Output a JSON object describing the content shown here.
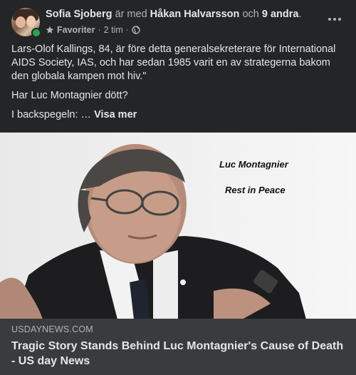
{
  "post": {
    "author": "Sofia Sjoberg",
    "with_text": "är med",
    "tagged_person": "Håkan Halvarsson",
    "and_text": "och",
    "others": "9 andra",
    "period": ".",
    "audience": "Favoriter",
    "separator": "·",
    "time": "2 tim",
    "separator2": "·",
    "paragraphs": [
      "Lars-Olof Kallings, 84, är före detta generalsekreterare för International AIDS Society, IAS, och har sedan 1985 varit en av strategerna bakom den globala kampen mot hiv.\"",
      "Har Luc Montagnier dött?"
    ],
    "last_line_prefix": "I backspegeln: …",
    "see_more": "Visa mer"
  },
  "image": {
    "caption_name": "Luc Montagnier",
    "caption_rip": "Rest in Peace"
  },
  "link": {
    "domain": "USDAYNEWS.COM",
    "title": "Tragic Story Stands Behind Luc Montagnier's Cause of Death - US day News"
  },
  "colors": {
    "background": "#242526",
    "link_card": "#3a3b3c",
    "online": "#31a24c",
    "text_primary": "#e4e6eb",
    "text_secondary": "#b0b3b8"
  }
}
